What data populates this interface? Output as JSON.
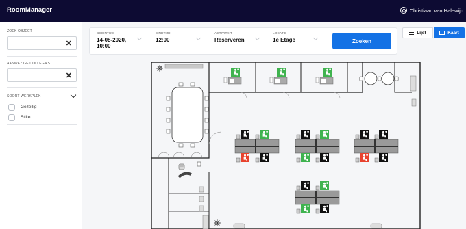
{
  "header": {
    "app_title": "RoomManager",
    "user_name": "Christiaan van Halewijn",
    "user_icon": "user-circle-icon",
    "bg_color": "#0d0b33"
  },
  "sidebar": {
    "search_object": {
      "label": "ZOEK OBJECT",
      "value": "",
      "clear_icon": "close-icon"
    },
    "colleagues": {
      "label": "AANWEZIGE COLLEGA'S",
      "value": "",
      "clear_icon": "close-icon"
    },
    "workspace_type": {
      "label": "SOORT WERKPLEK",
      "options": [
        {
          "label": "Gezellig",
          "checked": false
        },
        {
          "label": "Stilte",
          "checked": false
        }
      ]
    }
  },
  "search": {
    "start": {
      "label": "BEGINTIJD",
      "value_line1": "14-08-2020,",
      "value_line2": "10:00"
    },
    "end": {
      "label": "EINDTIJD",
      "value": "12:00"
    },
    "activity": {
      "label": "ACTIVITEIT",
      "value": "Reserveren"
    },
    "location": {
      "label": "LOCATIE",
      "value": "1e Etage"
    },
    "submit_label": "Zoeken",
    "accent_color": "#1472e5"
  },
  "view_toggle": {
    "list_label": "Lijst",
    "map_label": "Kaart",
    "active": "map"
  },
  "status_colors": {
    "available": "#3fb34f",
    "occupied": "#e8432e",
    "unavailable": "#111111"
  },
  "floorplan": {
    "rooms": [
      {
        "type": "available"
      },
      {
        "type": "available"
      },
      {
        "type": "available"
      }
    ],
    "desk_clusters": [
      {
        "desks": [
          "unavailable",
          "available",
          "occupied",
          "unavailable"
        ]
      },
      {
        "desks": [
          "unavailable",
          "available",
          "available",
          "unavailable"
        ]
      },
      {
        "desks": [
          "unavailable",
          "unavailable",
          "occupied",
          "unavailable"
        ]
      },
      {
        "desks": [
          "unavailable",
          "available",
          "available",
          "unavailable"
        ]
      }
    ]
  }
}
